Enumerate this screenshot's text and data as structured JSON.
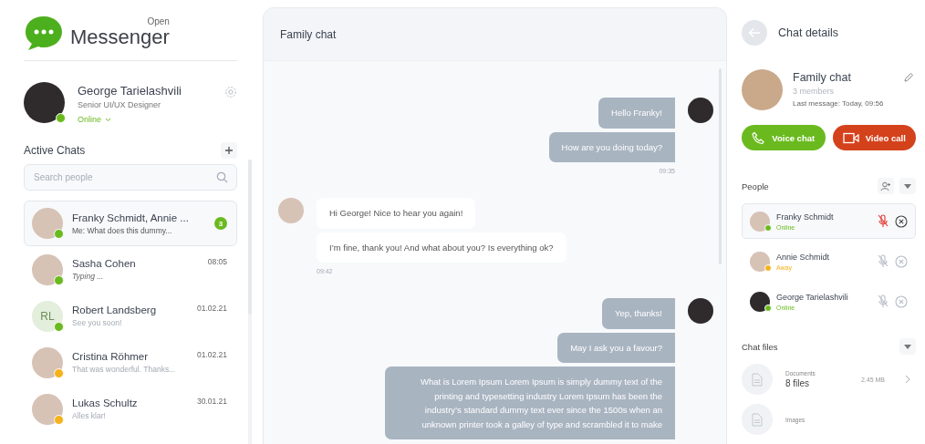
{
  "app": {
    "logo_small": "Open",
    "logo": "Messenger"
  },
  "profile": {
    "name": "George Tarielashvili",
    "role": "Senior UI/UX Designer",
    "status": "Online"
  },
  "active_chats": {
    "title": "Active Chats",
    "search": {
      "placeholder": "Search people"
    },
    "items": [
      {
        "name": "Franky Schmidt, Annie ...",
        "preview": "Me: What does this dummy...",
        "unread": "3",
        "selected": true,
        "color": "#6aba1f",
        "kind": "message"
      },
      {
        "name": "Sasha Cohen",
        "preview": "Typing ...",
        "time": "08:05",
        "selected": false,
        "color": "#6aba1f",
        "kind": "typing"
      },
      {
        "name": "Robert Landsberg",
        "preview": "See you soon!",
        "time": "01.02.21",
        "selected": false,
        "color": "#6aba1f",
        "kind": "message",
        "initials": "RL"
      },
      {
        "name": "Cristina Röhmer",
        "preview": "That was wonderful. Thanks...",
        "time": "01.02.21",
        "selected": false,
        "color": "#f5b21b",
        "kind": "message"
      },
      {
        "name": "Lukas Schultz",
        "preview": "Alles klar!",
        "time": "30.01.21",
        "selected": false,
        "color": "#f5b21b",
        "kind": "message"
      }
    ]
  },
  "chat": {
    "title": "Family chat",
    "groups": [
      {
        "kind": "out",
        "messages": [
          "Hello Franky!",
          "How are you doing today?"
        ],
        "time": "09:35"
      },
      {
        "kind": "in",
        "messages": [
          "Hi George! Nice to hear you again!",
          "I’m fine, thank you! And what about you? Is everything ok?"
        ],
        "time": "09:42"
      },
      {
        "kind": "out",
        "messages": [
          "Yep, thanks!",
          "May I ask you a favour?",
          "What is Lorem Ipsum Lorem Ipsum is simply dummy text of the printing and typesetting industry Lorem Ipsum has been the industry’s standard dummy text ever since the 1500s when an unknown printer took a galley of type and scrambled it to make"
        ]
      }
    ]
  },
  "details": {
    "title": "Chat details",
    "group": {
      "name": "Family chat",
      "members": "3 members",
      "last_message": "Last message:  Today, 09:56"
    },
    "actions": [
      {
        "kind": "voice",
        "label": "Voice chat"
      },
      {
        "kind": "video",
        "label": "Video call"
      }
    ],
    "people": {
      "title": "People",
      "items": [
        {
          "name": "Franky Schmidt",
          "status": "Online",
          "color": "#6aba1f",
          "selected": true
        },
        {
          "name": "Annie Schmidt",
          "status": "Away",
          "color": "#f5b21b",
          "selected": false
        },
        {
          "name": "George Tarielashvili",
          "status": "Online",
          "color": "#6aba1f",
          "selected": false
        }
      ]
    },
    "files": {
      "title": "Chat files",
      "items": [
        {
          "category": "Documents",
          "count": "8 files",
          "size": "2.45 MB"
        },
        {
          "category": "Images"
        }
      ]
    }
  }
}
